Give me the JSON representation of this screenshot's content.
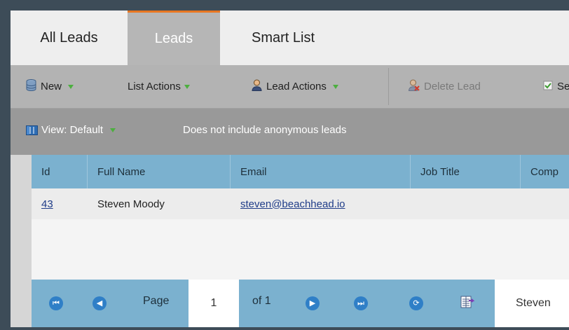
{
  "tabs": [
    {
      "label": "All Leads",
      "active": false
    },
    {
      "label": "Leads",
      "active": true
    },
    {
      "label": "Smart List",
      "active": false
    }
  ],
  "toolbar": {
    "new": "New",
    "list_actions": "List Actions",
    "lead_actions": "Lead Actions",
    "delete_lead": "Delete Lead",
    "cut_label": "Se"
  },
  "viewbar": {
    "view": "View: Default",
    "note": "Does not include anonymous leads"
  },
  "grid": {
    "columns": [
      "Id",
      "Full Name",
      "Email",
      "Job Title",
      "Comp"
    ],
    "rows": [
      {
        "id": "43",
        "full_name": "Steven Moody",
        "email": "steven@beachhead.io",
        "job_title": "",
        "company": ""
      }
    ]
  },
  "pager": {
    "page_label": "Page",
    "page_value": "1",
    "of_label": "of 1",
    "search_value": "Steven"
  },
  "colors": {
    "accent": "#e87722",
    "grid_header": "#7bb1cf",
    "toolbar": "#b3b3b3",
    "view_bar": "#999999",
    "nav_button": "#2f7fc7"
  }
}
